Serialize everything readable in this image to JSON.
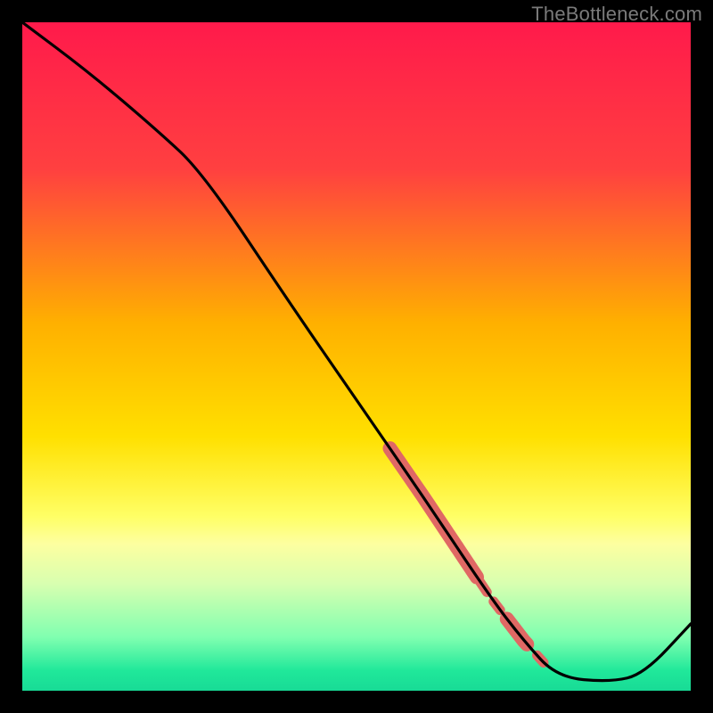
{
  "watermark": "TheBottleneck.com",
  "chart_data": {
    "type": "line",
    "title": "",
    "xlabel": "",
    "ylabel": "",
    "xlim": [
      0,
      100
    ],
    "ylim": [
      0,
      100
    ],
    "gradient_stops": [
      {
        "offset": 0,
        "color": "#ff1a4b"
      },
      {
        "offset": 22,
        "color": "#ff4040"
      },
      {
        "offset": 45,
        "color": "#ffb000"
      },
      {
        "offset": 62,
        "color": "#ffe000"
      },
      {
        "offset": 74,
        "color": "#ffff66"
      },
      {
        "offset": 78,
        "color": "#fdffa0"
      },
      {
        "offset": 84,
        "color": "#d8ffb0"
      },
      {
        "offset": 92,
        "color": "#80ffb0"
      },
      {
        "offset": 97,
        "color": "#20e89a"
      },
      {
        "offset": 100,
        "color": "#18db96"
      }
    ],
    "series": [
      {
        "name": "curve",
        "color": "#000000",
        "x": [
          0,
          10,
          20,
          27,
          40,
          50,
          60,
          70,
          75,
          80,
          88,
          93,
          100
        ],
        "y": [
          100,
          92.5,
          84,
          77.5,
          58,
          43.5,
          29,
          14,
          7.5,
          2,
          1.3,
          2.5,
          10
        ]
      }
    ],
    "marker_cluster": {
      "color": "#e06864",
      "segments": [
        {
          "x_range": [
            55,
            65
          ],
          "thick": true
        },
        {
          "x_range": [
            65,
            68
          ],
          "thick": true
        },
        {
          "x_range": [
            68.5,
            69.5
          ],
          "thick": false
        },
        {
          "x_range": [
            70.5,
            71.5
          ],
          "thick": false
        },
        {
          "x_range": [
            72.5,
            75.5
          ],
          "thick": true
        },
        {
          "x_range": [
            77,
            78
          ],
          "thick": false
        }
      ]
    }
  }
}
